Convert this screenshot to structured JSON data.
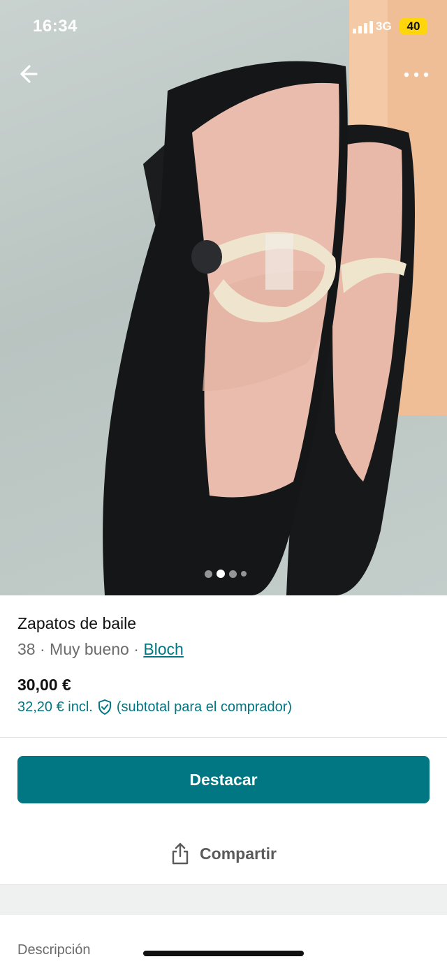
{
  "status_bar": {
    "time": "16:34",
    "network": "3G",
    "battery": "40"
  },
  "carousel": {
    "total": 4,
    "active_index": 1,
    "icons": {
      "back": "arrow-left-icon",
      "more": "more-horizontal-icon"
    }
  },
  "listing": {
    "title": "Zapatos de baile",
    "size": "38",
    "separator": "·",
    "condition": "Muy bueno",
    "brand": "Bloch",
    "price": "30,00 €",
    "price_incl": "32,20 € incl.",
    "price_incl_note": "(subtotal para el comprador)"
  },
  "actions": {
    "primary_label": "Destacar",
    "share_label": "Compartir"
  },
  "section": {
    "description_label": "Descripción"
  },
  "colors": {
    "accent": "#007782",
    "battery": "#ffd60a"
  }
}
